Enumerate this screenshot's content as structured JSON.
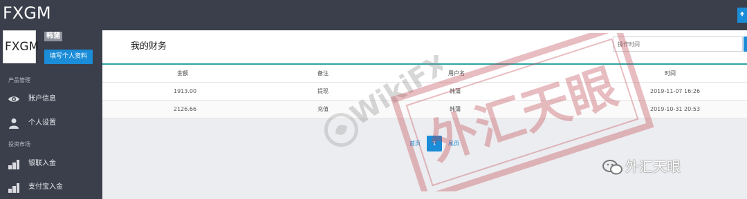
{
  "brand": {
    "logo_text": "FXGM"
  },
  "profile": {
    "logo_text": "FXGM",
    "username": "韩蒲",
    "fill_button": "填写个人资料"
  },
  "sidebar": {
    "sections": [
      {
        "title": "产品管理"
      },
      {
        "title": "投资市场"
      }
    ],
    "items": [
      {
        "label": "账户信息",
        "icon": "eye-icon"
      },
      {
        "label": "个人设置",
        "icon": "user-icon"
      },
      {
        "label": "银联入金",
        "icon": "deposit-icon"
      },
      {
        "label": "支付宝入金",
        "icon": "deposit-icon"
      }
    ]
  },
  "main": {
    "title": "我的财务",
    "date_placeholder": "操作时间",
    "table": {
      "headers": [
        "金额",
        "备注",
        "用户名",
        "时间"
      ],
      "rows": [
        [
          "1913.00",
          "提现",
          "韩蒲",
          "2019-11-07 16:26"
        ],
        [
          "2126.66",
          "充值",
          "韩蒲",
          "2019-10-31 20:53"
        ]
      ]
    },
    "pagination": {
      "first": "首页",
      "current": "1",
      "last": "尾页"
    }
  },
  "watermark": {
    "brand_text": "WikiFX",
    "stamp_text": "外汇天眼",
    "wechat_text": "外汇天眼"
  },
  "colors": {
    "sidebar_bg": "#3b3f4c",
    "accent": "#1a8cd8",
    "table_top_line": "#2aa5a3",
    "stamp": "#c0464f"
  }
}
